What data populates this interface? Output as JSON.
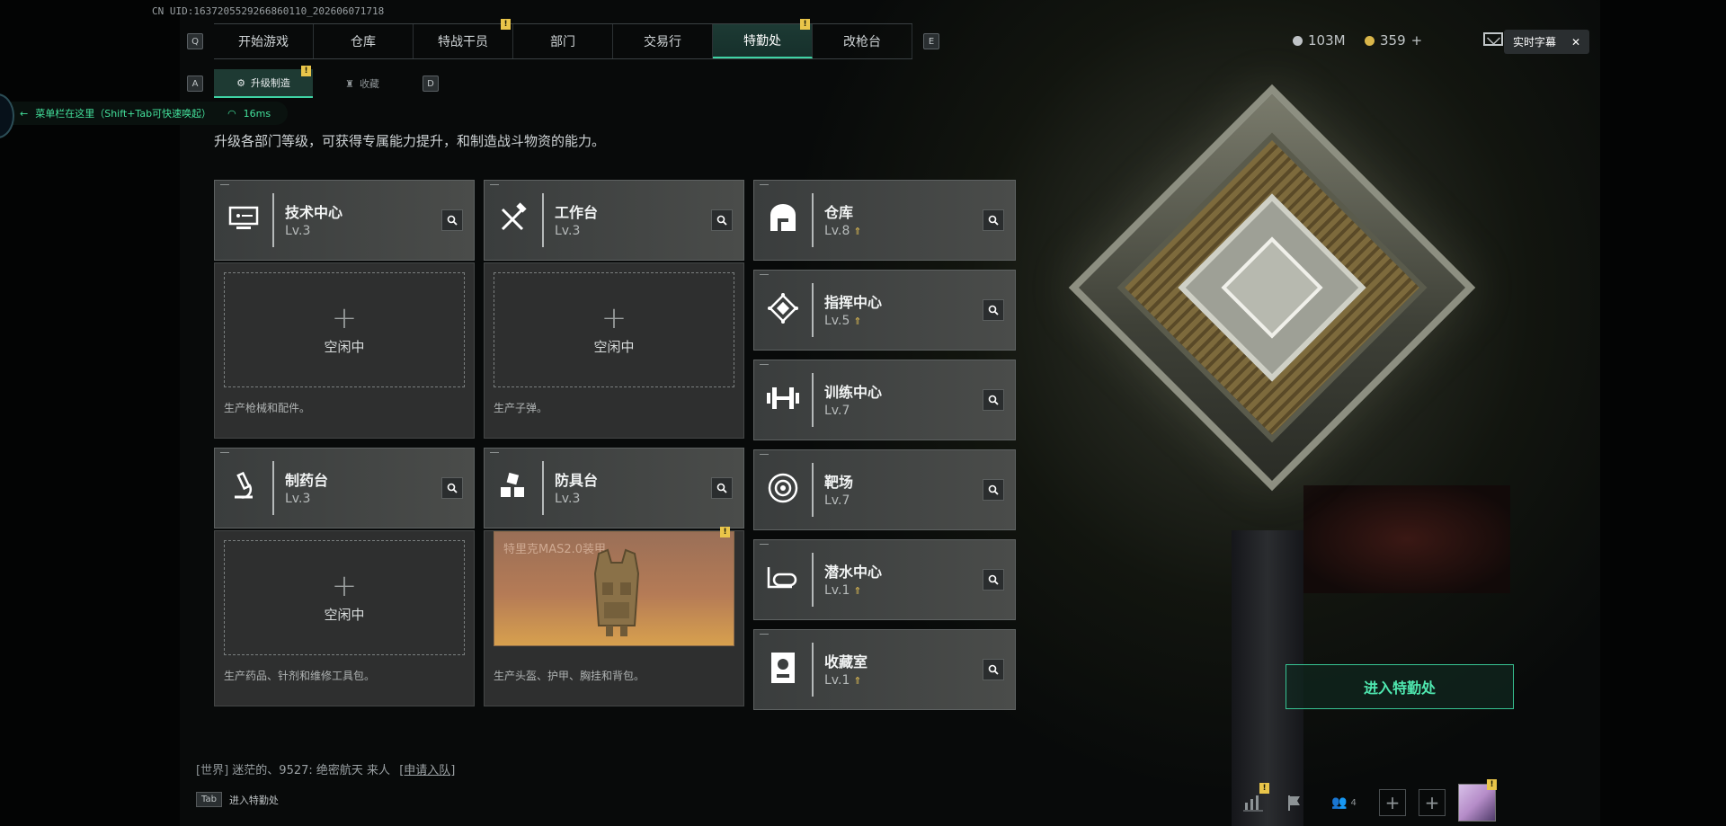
{
  "uid_text": "CN UID:1637205529266860110_202606071718",
  "nav": {
    "key_left": "Q",
    "key_right": "E",
    "tabs": [
      {
        "label": "开始游戏",
        "badge": ""
      },
      {
        "label": "仓库",
        "badge": ""
      },
      {
        "label": "特战干员",
        "badge": "!"
      },
      {
        "label": "部门",
        "badge": ""
      },
      {
        "label": "交易行",
        "badge": ""
      },
      {
        "label": "特勤处",
        "badge": "!"
      },
      {
        "label": "改枪台",
        "badge": ""
      }
    ],
    "active_index": 5
  },
  "subnav": {
    "key_left": "A",
    "key_right": "D",
    "tabs": [
      {
        "label": "升级制造",
        "badge": "!"
      },
      {
        "label": "收藏",
        "badge": ""
      }
    ]
  },
  "resources": {
    "silver": "103M",
    "gold": "359",
    "gold_add": "+"
  },
  "caption": {
    "label": "实时字幕",
    "close": "✕"
  },
  "overlay": {
    "menu_hint": "菜单栏在这里（Shift+Tab可快速唤起）",
    "ping": "16ms"
  },
  "description": "升级各部门等级，可获得专属能力提升，和制造战斗物资的能力。",
  "production_cards": [
    {
      "name": "技术中心",
      "level": "Lv.3",
      "icon": "computer-icon",
      "slot": {
        "state": "空闲中",
        "hint": "生产枪械和配件。"
      }
    },
    {
      "name": "工作台",
      "level": "Lv.3",
      "icon": "tools-icon",
      "slot": {
        "state": "空闲中",
        "hint": "生产子弹。"
      }
    },
    {
      "name": "制药台",
      "level": "Lv.3",
      "icon": "microscope-icon",
      "slot": {
        "state": "空闲中",
        "hint": "生产药品、针剂和维修工具包。"
      }
    },
    {
      "name": "防具台",
      "level": "Lv.3",
      "icon": "armor-boxes-icon",
      "slot": {
        "item": "特里克MAS2.0装甲",
        "badge": "!",
        "hint": "生产头盔、护甲、胸挂和背包。"
      }
    }
  ],
  "facilities": [
    {
      "name": "仓库",
      "level": "Lv.8",
      "upgradable": true,
      "icon": "warehouse-icon"
    },
    {
      "name": "指挥中心",
      "level": "Lv.5",
      "upgradable": true,
      "icon": "command-icon"
    },
    {
      "name": "训练中心",
      "level": "Lv.7",
      "upgradable": false,
      "icon": "dumbbell-icon"
    },
    {
      "name": "靶场",
      "level": "Lv.7",
      "upgradable": false,
      "icon": "target-icon"
    },
    {
      "name": "潜水中心",
      "level": "Lv.1",
      "upgradable": true,
      "icon": "diving-goggles-icon"
    },
    {
      "name": "收藏室",
      "level": "Lv.1",
      "upgradable": true,
      "icon": "collection-icon"
    }
  ],
  "enter_button": "进入特勤处",
  "chat": {
    "channel": "[世界]",
    "user": "迷茫的、9527:",
    "message": "绝密航天 来人",
    "link": "[申请入队]"
  },
  "tab_hint": {
    "key": "Tab",
    "label": "进入特勤处"
  },
  "bottom_bar": {
    "friends_count": "4",
    "avatar_badge": "!",
    "stats_badge": "!"
  },
  "colors": {
    "accent": "#3fd4a5",
    "badge": "#e9c54a",
    "upgrade_arrow": "#e3bf53"
  }
}
